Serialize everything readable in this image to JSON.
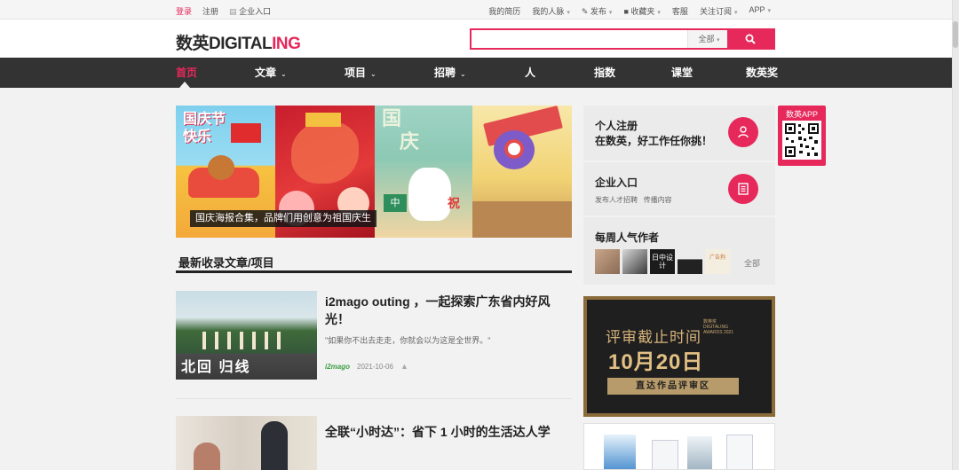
{
  "topbar": {
    "login": "登录",
    "register": "注册",
    "enterprise": "企业入口",
    "right_items": [
      "我的简历",
      "我的人脉",
      "发布",
      "收藏夹",
      "客服",
      "关注订阅",
      "APP"
    ]
  },
  "header": {
    "logo_main": "数英DIGITAL",
    "logo_accent": "ING",
    "search_placeholder": "",
    "search_scope": "全部"
  },
  "nav": {
    "items": [
      "首页",
      "文章",
      "项目",
      "招聘",
      "人",
      "指数",
      "课堂",
      "数英奖"
    ]
  },
  "banner": {
    "caption": "国庆海报合集，品牌们用创意为祖国庆生",
    "poster_text_1": "国庆节",
    "poster_text_2": "快乐",
    "poster_text_3": "国",
    "poster_text_4": "庆",
    "poster_text_5": "中",
    "poster_text_6": "祝"
  },
  "latest": {
    "title": "最新收录文章/项目",
    "articles": [
      {
        "title": "i2mago outing ，一起探索广东省内好风光！",
        "desc": "\"如果你不出去走走，你就会以为这是全世界。\"",
        "source": "i2mago",
        "date": "2021-10-06",
        "thumb_text": "北回 归线"
      },
      {
        "title": "全联“小时达”：省下 1 小时的生活达人学"
      }
    ]
  },
  "sidebar": {
    "personal": {
      "title": "个人注册",
      "subtitle": "在数英，好工作任你挑！"
    },
    "enterprise": {
      "title": "企业入口",
      "sub1": "发布人才招聘",
      "sub2": "传播内容"
    },
    "authors": {
      "title": "每周人气作者",
      "all": "全部",
      "author3_text": "日中设计",
      "author5_text": "广告狗"
    },
    "award": {
      "line1": "评审截止时间",
      "line2": "10月20日",
      "button": "直达作品评审区",
      "badge": "数英奖 DIGITALING AWARDS 2021"
    },
    "app": {
      "label": "数英APP"
    }
  },
  "colors": {
    "brand": "#e6285b",
    "nav_bg": "#333333"
  }
}
